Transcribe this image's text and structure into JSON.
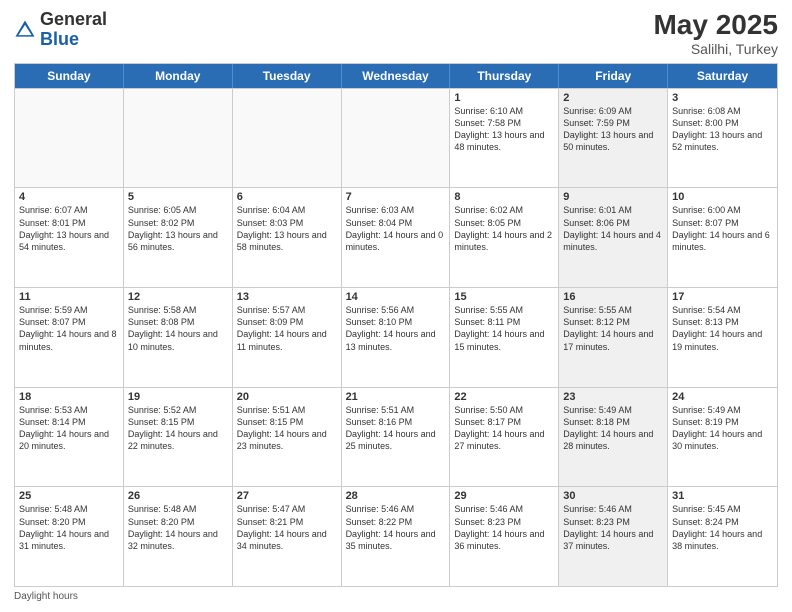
{
  "header": {
    "logo_general": "General",
    "logo_blue": "Blue",
    "month_year": "May 2025",
    "location": "Salilhi, Turkey"
  },
  "days_of_week": [
    "Sunday",
    "Monday",
    "Tuesday",
    "Wednesday",
    "Thursday",
    "Friday",
    "Saturday"
  ],
  "weeks": [
    [
      {
        "day": "",
        "sunrise": "",
        "sunset": "",
        "daylight": "",
        "shaded": false
      },
      {
        "day": "",
        "sunrise": "",
        "sunset": "",
        "daylight": "",
        "shaded": false
      },
      {
        "day": "",
        "sunrise": "",
        "sunset": "",
        "daylight": "",
        "shaded": false
      },
      {
        "day": "",
        "sunrise": "",
        "sunset": "",
        "daylight": "",
        "shaded": false
      },
      {
        "day": "1",
        "sunrise": "Sunrise: 6:10 AM",
        "sunset": "Sunset: 7:58 PM",
        "daylight": "Daylight: 13 hours and 48 minutes.",
        "shaded": false
      },
      {
        "day": "2",
        "sunrise": "Sunrise: 6:09 AM",
        "sunset": "Sunset: 7:59 PM",
        "daylight": "Daylight: 13 hours and 50 minutes.",
        "shaded": true
      },
      {
        "day": "3",
        "sunrise": "Sunrise: 6:08 AM",
        "sunset": "Sunset: 8:00 PM",
        "daylight": "Daylight: 13 hours and 52 minutes.",
        "shaded": false
      }
    ],
    [
      {
        "day": "4",
        "sunrise": "Sunrise: 6:07 AM",
        "sunset": "Sunset: 8:01 PM",
        "daylight": "Daylight: 13 hours and 54 minutes.",
        "shaded": false
      },
      {
        "day": "5",
        "sunrise": "Sunrise: 6:05 AM",
        "sunset": "Sunset: 8:02 PM",
        "daylight": "Daylight: 13 hours and 56 minutes.",
        "shaded": false
      },
      {
        "day": "6",
        "sunrise": "Sunrise: 6:04 AM",
        "sunset": "Sunset: 8:03 PM",
        "daylight": "Daylight: 13 hours and 58 minutes.",
        "shaded": false
      },
      {
        "day": "7",
        "sunrise": "Sunrise: 6:03 AM",
        "sunset": "Sunset: 8:04 PM",
        "daylight": "Daylight: 14 hours and 0 minutes.",
        "shaded": false
      },
      {
        "day": "8",
        "sunrise": "Sunrise: 6:02 AM",
        "sunset": "Sunset: 8:05 PM",
        "daylight": "Daylight: 14 hours and 2 minutes.",
        "shaded": false
      },
      {
        "day": "9",
        "sunrise": "Sunrise: 6:01 AM",
        "sunset": "Sunset: 8:06 PM",
        "daylight": "Daylight: 14 hours and 4 minutes.",
        "shaded": true
      },
      {
        "day": "10",
        "sunrise": "Sunrise: 6:00 AM",
        "sunset": "Sunset: 8:07 PM",
        "daylight": "Daylight: 14 hours and 6 minutes.",
        "shaded": false
      }
    ],
    [
      {
        "day": "11",
        "sunrise": "Sunrise: 5:59 AM",
        "sunset": "Sunset: 8:07 PM",
        "daylight": "Daylight: 14 hours and 8 minutes.",
        "shaded": false
      },
      {
        "day": "12",
        "sunrise": "Sunrise: 5:58 AM",
        "sunset": "Sunset: 8:08 PM",
        "daylight": "Daylight: 14 hours and 10 minutes.",
        "shaded": false
      },
      {
        "day": "13",
        "sunrise": "Sunrise: 5:57 AM",
        "sunset": "Sunset: 8:09 PM",
        "daylight": "Daylight: 14 hours and 11 minutes.",
        "shaded": false
      },
      {
        "day": "14",
        "sunrise": "Sunrise: 5:56 AM",
        "sunset": "Sunset: 8:10 PM",
        "daylight": "Daylight: 14 hours and 13 minutes.",
        "shaded": false
      },
      {
        "day": "15",
        "sunrise": "Sunrise: 5:55 AM",
        "sunset": "Sunset: 8:11 PM",
        "daylight": "Daylight: 14 hours and 15 minutes.",
        "shaded": false
      },
      {
        "day": "16",
        "sunrise": "Sunrise: 5:55 AM",
        "sunset": "Sunset: 8:12 PM",
        "daylight": "Daylight: 14 hours and 17 minutes.",
        "shaded": true
      },
      {
        "day": "17",
        "sunrise": "Sunrise: 5:54 AM",
        "sunset": "Sunset: 8:13 PM",
        "daylight": "Daylight: 14 hours and 19 minutes.",
        "shaded": false
      }
    ],
    [
      {
        "day": "18",
        "sunrise": "Sunrise: 5:53 AM",
        "sunset": "Sunset: 8:14 PM",
        "daylight": "Daylight: 14 hours and 20 minutes.",
        "shaded": false
      },
      {
        "day": "19",
        "sunrise": "Sunrise: 5:52 AM",
        "sunset": "Sunset: 8:15 PM",
        "daylight": "Daylight: 14 hours and 22 minutes.",
        "shaded": false
      },
      {
        "day": "20",
        "sunrise": "Sunrise: 5:51 AM",
        "sunset": "Sunset: 8:15 PM",
        "daylight": "Daylight: 14 hours and 23 minutes.",
        "shaded": false
      },
      {
        "day": "21",
        "sunrise": "Sunrise: 5:51 AM",
        "sunset": "Sunset: 8:16 PM",
        "daylight": "Daylight: 14 hours and 25 minutes.",
        "shaded": false
      },
      {
        "day": "22",
        "sunrise": "Sunrise: 5:50 AM",
        "sunset": "Sunset: 8:17 PM",
        "daylight": "Daylight: 14 hours and 27 minutes.",
        "shaded": false
      },
      {
        "day": "23",
        "sunrise": "Sunrise: 5:49 AM",
        "sunset": "Sunset: 8:18 PM",
        "daylight": "Daylight: 14 hours and 28 minutes.",
        "shaded": true
      },
      {
        "day": "24",
        "sunrise": "Sunrise: 5:49 AM",
        "sunset": "Sunset: 8:19 PM",
        "daylight": "Daylight: 14 hours and 30 minutes.",
        "shaded": false
      }
    ],
    [
      {
        "day": "25",
        "sunrise": "Sunrise: 5:48 AM",
        "sunset": "Sunset: 8:20 PM",
        "daylight": "Daylight: 14 hours and 31 minutes.",
        "shaded": false
      },
      {
        "day": "26",
        "sunrise": "Sunrise: 5:48 AM",
        "sunset": "Sunset: 8:20 PM",
        "daylight": "Daylight: 14 hours and 32 minutes.",
        "shaded": false
      },
      {
        "day": "27",
        "sunrise": "Sunrise: 5:47 AM",
        "sunset": "Sunset: 8:21 PM",
        "daylight": "Daylight: 14 hours and 34 minutes.",
        "shaded": false
      },
      {
        "day": "28",
        "sunrise": "Sunrise: 5:46 AM",
        "sunset": "Sunset: 8:22 PM",
        "daylight": "Daylight: 14 hours and 35 minutes.",
        "shaded": false
      },
      {
        "day": "29",
        "sunrise": "Sunrise: 5:46 AM",
        "sunset": "Sunset: 8:23 PM",
        "daylight": "Daylight: 14 hours and 36 minutes.",
        "shaded": false
      },
      {
        "day": "30",
        "sunrise": "Sunrise: 5:46 AM",
        "sunset": "Sunset: 8:23 PM",
        "daylight": "Daylight: 14 hours and 37 minutes.",
        "shaded": true
      },
      {
        "day": "31",
        "sunrise": "Sunrise: 5:45 AM",
        "sunset": "Sunset: 8:24 PM",
        "daylight": "Daylight: 14 hours and 38 minutes.",
        "shaded": false
      }
    ]
  ],
  "footer": {
    "note": "Daylight hours"
  },
  "colors": {
    "header_bg": "#2a6db5",
    "shaded_cell": "#f0f0f0",
    "normal_cell": "#ffffff",
    "empty_cell": "#f9f9f9"
  }
}
